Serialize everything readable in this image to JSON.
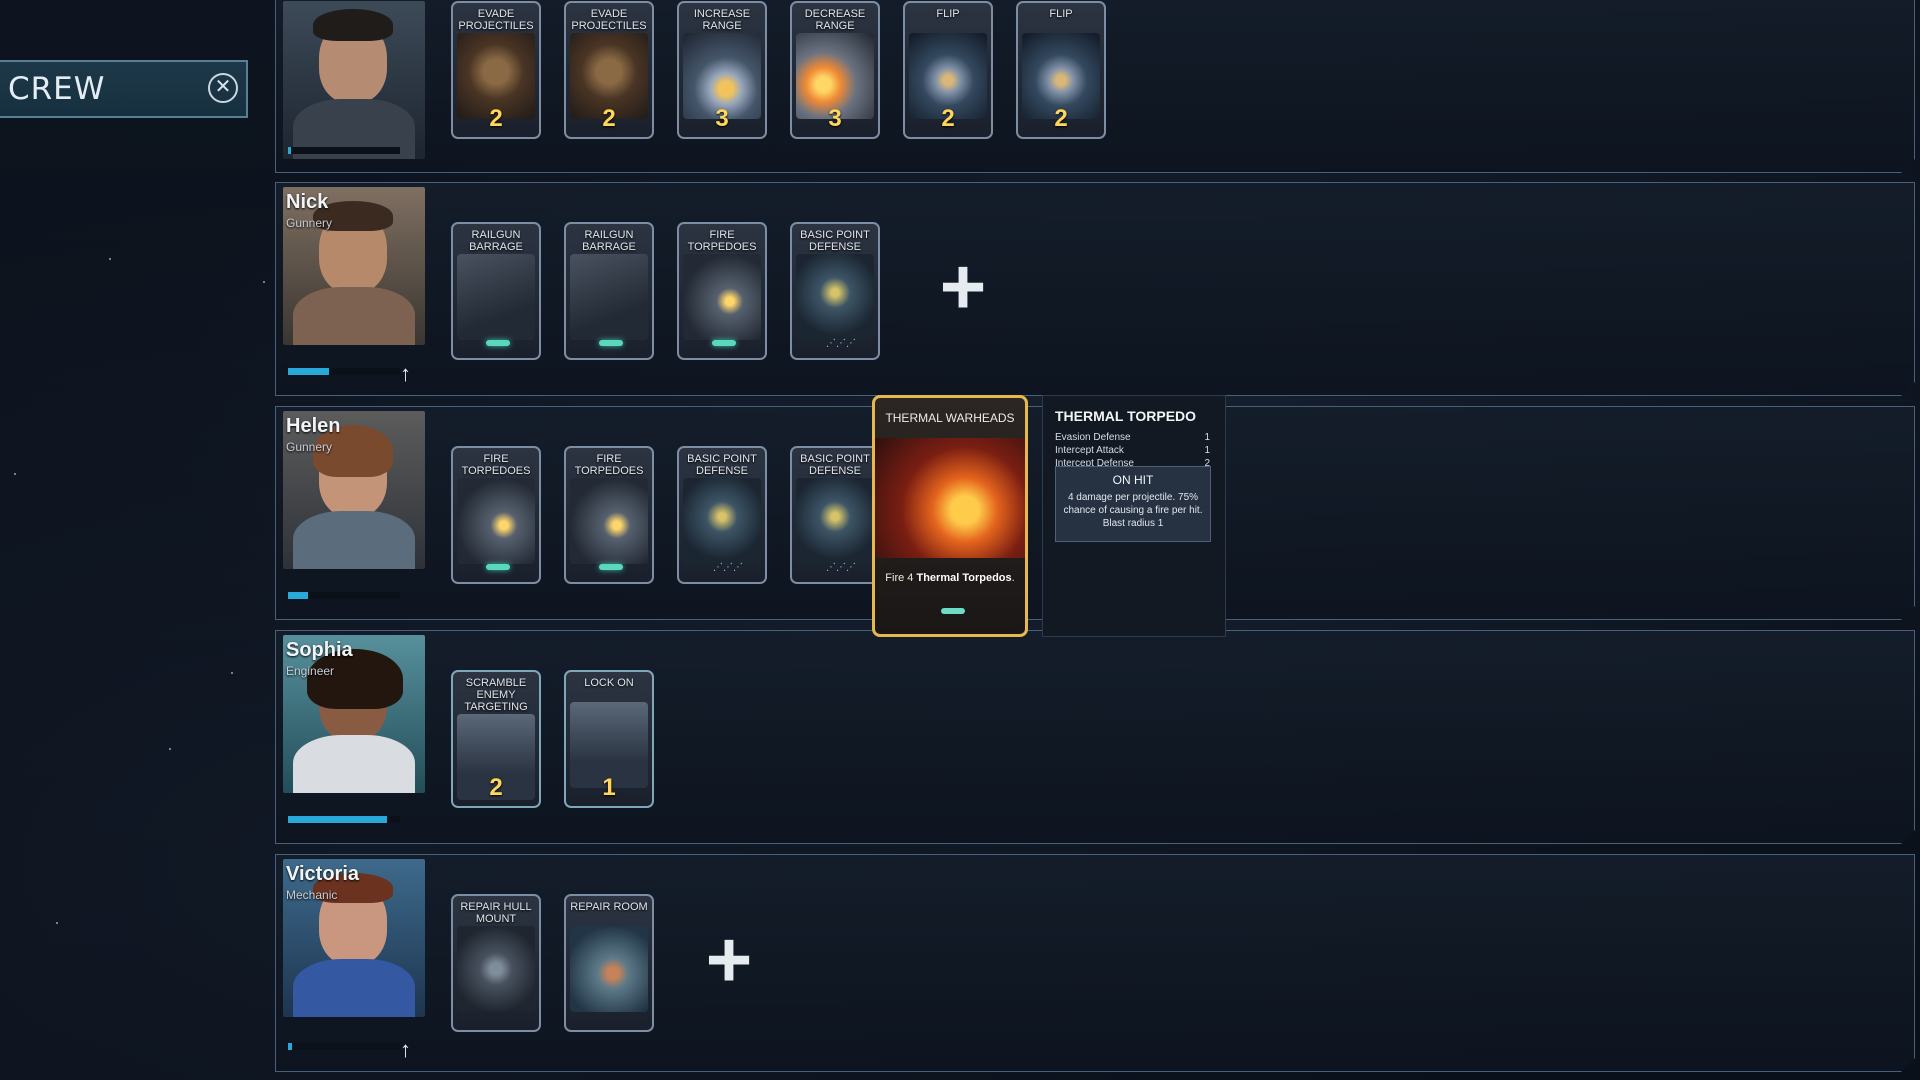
{
  "header": {
    "title": "CREW"
  },
  "rows": [
    {
      "name": "",
      "role": "",
      "cards": [
        {
          "title": "EVADE PROJECTILES",
          "cost": "2",
          "icon": ""
        },
        {
          "title": "EVADE PROJECTILES",
          "cost": "2",
          "icon": ""
        },
        {
          "title": "INCREASE RANGE",
          "cost": "3",
          "icon": ""
        },
        {
          "title": "DECREASE RANGE",
          "cost": "3",
          "icon": ""
        },
        {
          "title": "FLIP",
          "cost": "2",
          "icon": ""
        },
        {
          "title": "FLIP",
          "cost": "2",
          "icon": ""
        }
      ]
    },
    {
      "name": "Nick",
      "role": "Gunnery",
      "cards": [
        {
          "title": "RAILGUN BARRAGE",
          "cost": "",
          "icon": "railgun-ammo-icon"
        },
        {
          "title": "RAILGUN BARRAGE",
          "cost": "",
          "icon": "railgun-ammo-icon"
        },
        {
          "title": "FIRE TORPEDOES",
          "cost": "",
          "icon": "torpedo-ammo-icon"
        },
        {
          "title": "BASIC POINT DEFENSE",
          "cost": "",
          "icon": "point-defense-icon"
        }
      ]
    },
    {
      "name": "Helen",
      "role": "Gunnery",
      "cards": [
        {
          "title": "FIRE TORPEDOES",
          "cost": "",
          "icon": "torpedo-ammo-icon"
        },
        {
          "title": "FIRE TORPEDOES",
          "cost": "",
          "icon": "torpedo-ammo-icon"
        },
        {
          "title": "BASIC POINT DEFENSE",
          "cost": "",
          "icon": "point-defense-icon"
        },
        {
          "title": "BASIC POINT DEFENSE",
          "cost": "",
          "icon": "point-defense-icon"
        }
      ]
    },
    {
      "name": "Sophia",
      "role": "Engineer",
      "cards": [
        {
          "title": "SCRAMBLE ENEMY TARGETING",
          "cost": "2",
          "icon": ""
        },
        {
          "title": "LOCK ON",
          "cost": "1",
          "icon": ""
        }
      ]
    },
    {
      "name": "Victoria",
      "role": "Mechanic",
      "cards": [
        {
          "title": "REPAIR HULL MOUNT",
          "cost": "",
          "icon": ""
        },
        {
          "title": "REPAIR ROOM",
          "cost": "",
          "icon": ""
        }
      ]
    }
  ],
  "hover_card": {
    "title": "THERMAL WARHEADS",
    "desc_prefix": "Fire 4 ",
    "desc_highlight": "Thermal Torpedos",
    "desc_suffix": "."
  },
  "tooltip": {
    "title": "THERMAL TORPEDO",
    "stats": [
      {
        "label": "Evasion Defense",
        "value": "1"
      },
      {
        "label": "Intercept Attack",
        "value": "1"
      },
      {
        "label": "Intercept Defense",
        "value": "2"
      }
    ],
    "on_hit_title": "ON HIT",
    "on_hit_text": "4 damage per projectile. 75% chance of causing a fire per hit. Blast radius 1"
  },
  "colors": {
    "accent": "#ffd659",
    "xp_fill": "#29a9d9",
    "hover_border": "#e6b84e",
    "panel_border": "#48607c"
  },
  "xp_levels": {
    "row_0": 0.03,
    "nick": 0.37,
    "helen": 0.18,
    "sophia": 0.88,
    "victoria": 0.04
  }
}
